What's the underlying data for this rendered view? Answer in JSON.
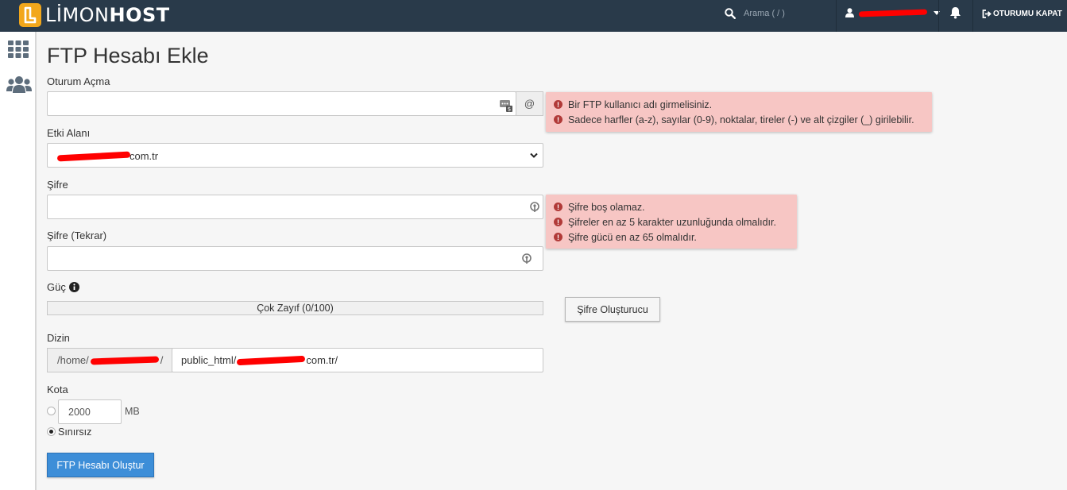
{
  "app": {
    "brand_light": "LİMON",
    "brand_bold": "HOST",
    "search_placeholder": "Arama ( / )",
    "logout_label": "OTURUMU KAPAT"
  },
  "page": {
    "title": "FTP Hesabı Ekle"
  },
  "form": {
    "login_label": "Oturum Açma",
    "login_value": "",
    "at_symbol": "@",
    "domain_label": "Etki Alanı",
    "domain_value_suffix": "com.tr",
    "password_label": "Şifre",
    "password_value": "",
    "password_repeat_label": "Şifre (Tekrar)",
    "password_repeat_value": "",
    "strength_label": "Güç",
    "strength_text": "Çok Zayıf (0/100)",
    "strength_value": 0,
    "generator_button": "Şifre Oluşturucu",
    "dir_label": "Dizin",
    "dir_prefix": "/home/",
    "dir_prefix_end": "/",
    "dir_value_start": "public_html/",
    "dir_value_end": "com.tr/",
    "quota_label": "Kota",
    "quota_value": "2000",
    "quota_unit": "MB",
    "unlimited_label": "Sınırsız",
    "submit_button": "FTP Hesabı Oluştur"
  },
  "errors": {
    "login": [
      "Bir FTP kullanıcı adı girmelisiniz.",
      "Sadece harfler (a-z), sayılar (0-9), noktalar, tireler (-) ve alt çizgiler (_) girilebilir."
    ],
    "password": [
      "Şifre boş olamaz.",
      "Şifreler en az 5 karakter uzunluğunda olmalıdır.",
      "Şifre gücü en az 65 olmalıdır."
    ]
  },
  "colors": {
    "topbar": "#293a4a",
    "brand_accent": "#f2a71b",
    "error_bg": "#f7c6c4",
    "error_icon": "#b13a38",
    "primary": "#3d8ed8"
  }
}
